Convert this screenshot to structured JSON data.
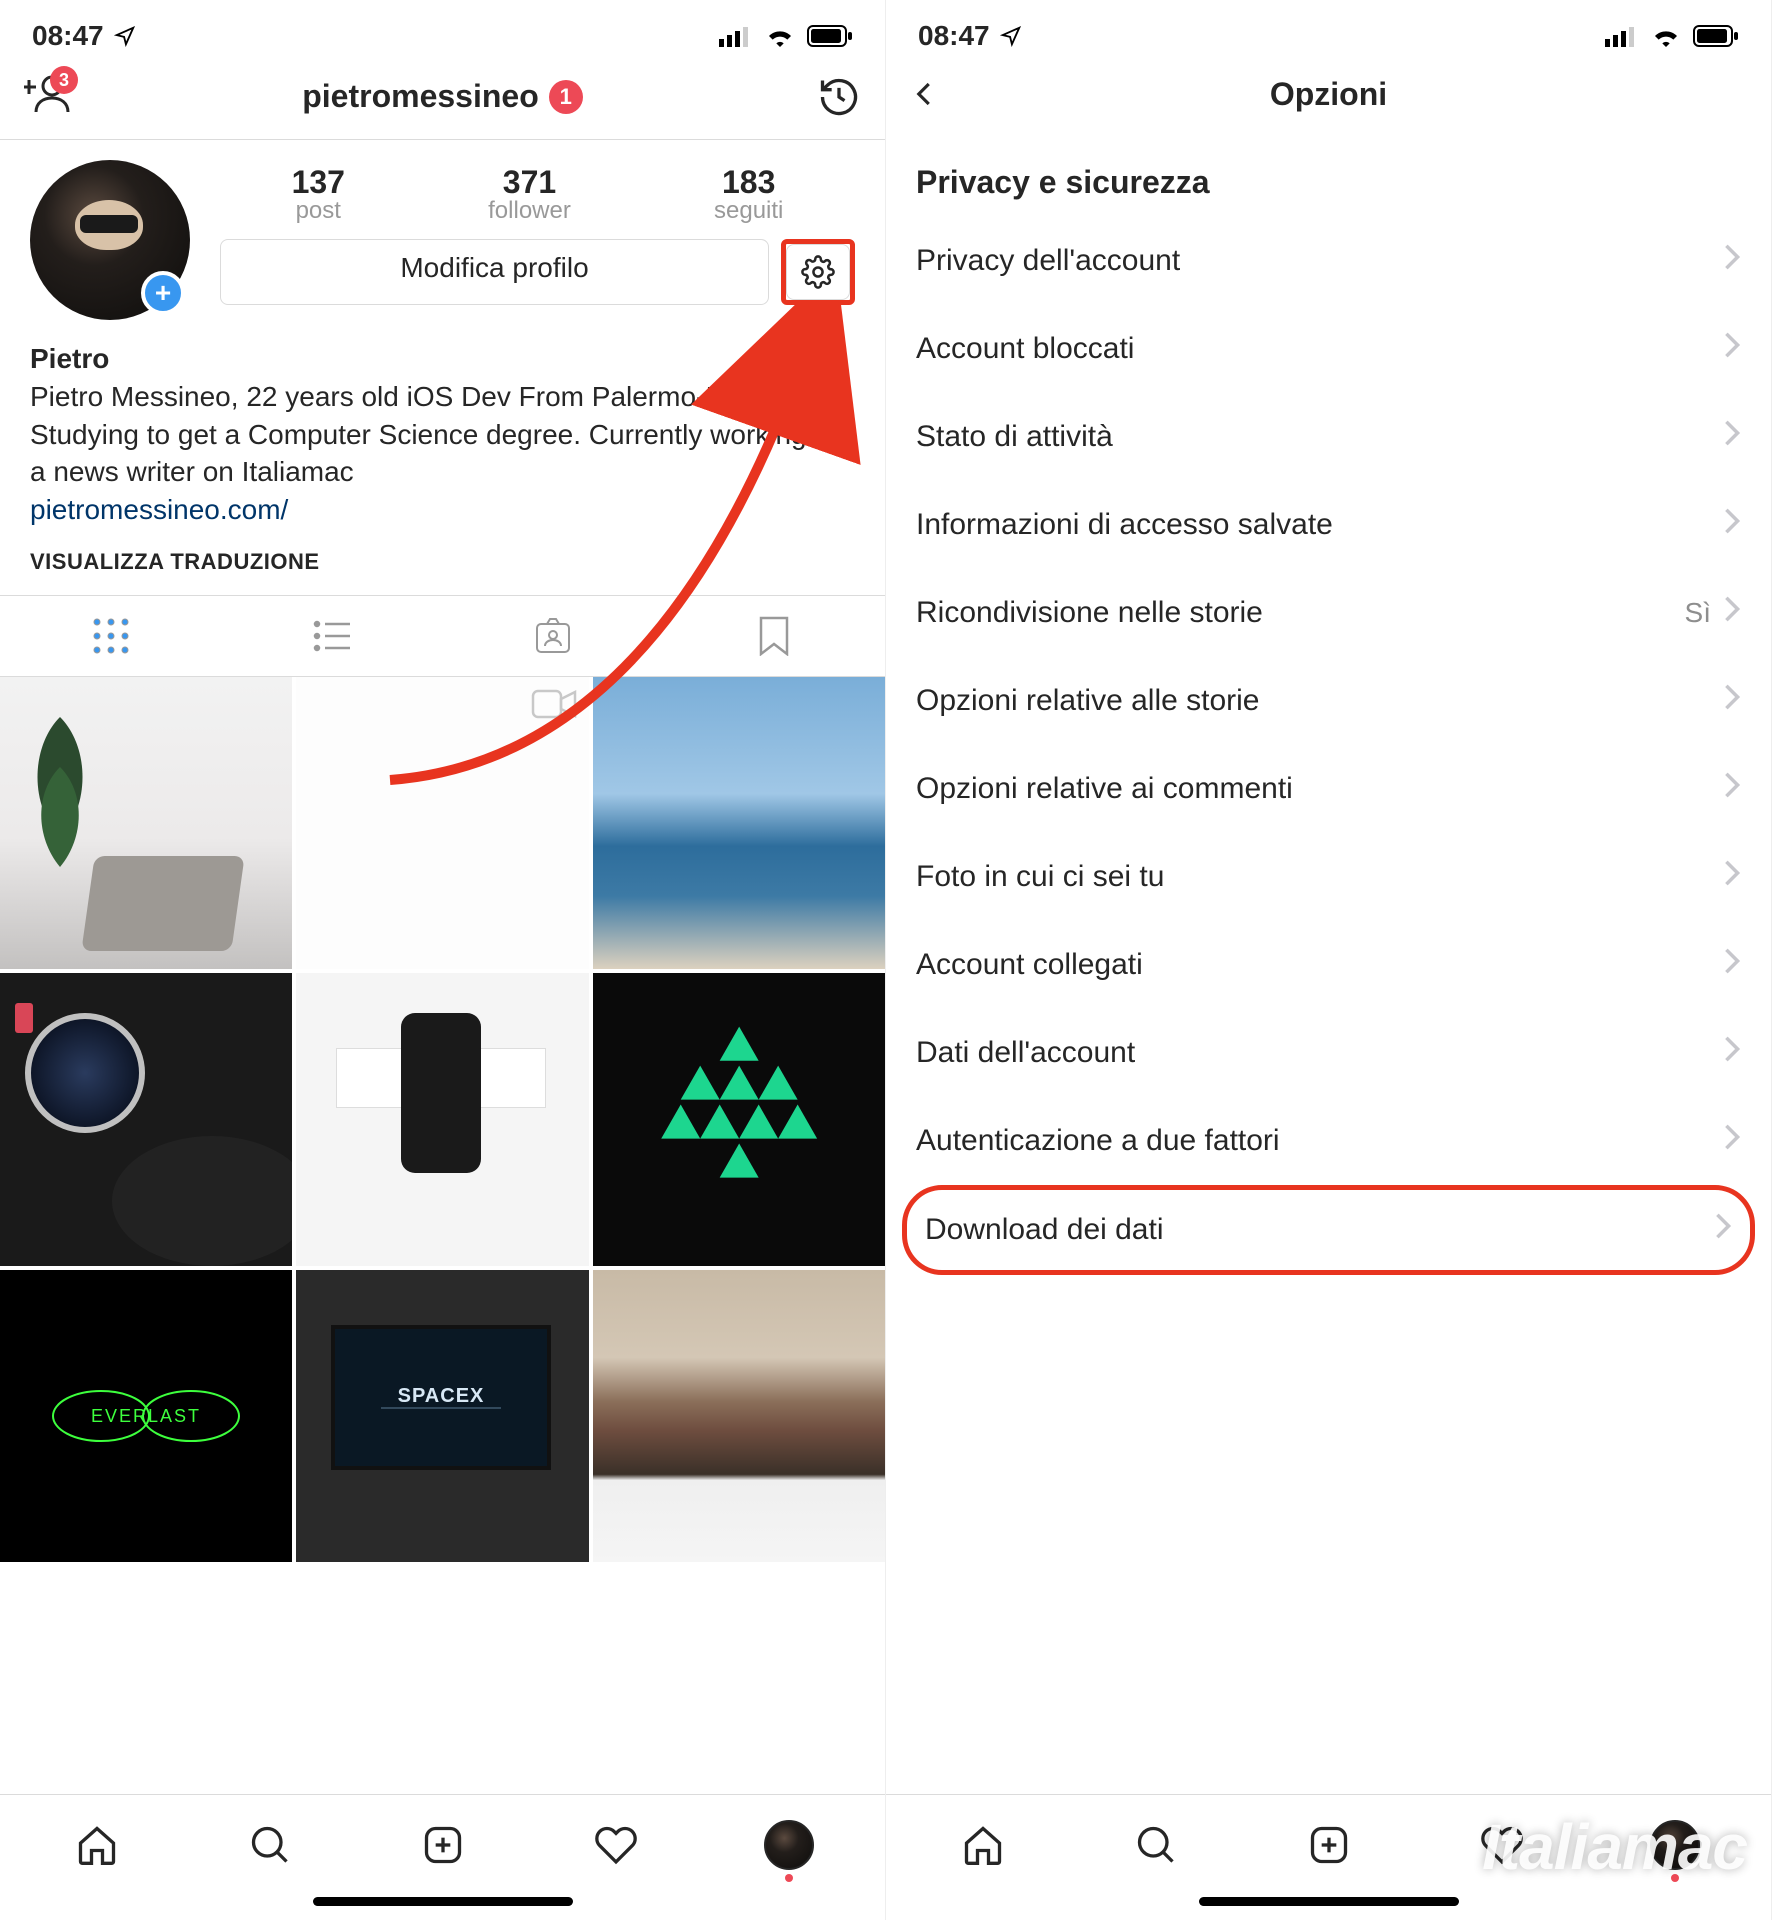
{
  "status": {
    "time": "08:47"
  },
  "left": {
    "add_people_badge": "3",
    "username": "pietromessineo",
    "username_badge": "1",
    "stats": {
      "posts": {
        "num": "137",
        "lbl": "post"
      },
      "followers": {
        "num": "371",
        "lbl": "follower"
      },
      "following": {
        "num": "183",
        "lbl": "seguiti"
      }
    },
    "edit_profile": "Modifica profilo",
    "bio_name": "Pietro ",
    "bio_text": "Pietro Messineo, 22 years old iOS Dev From Palermo-Italy 🇮🇹Studying to get a Computer Science degree. Currently working as a news writer on Italiamac",
    "bio_link": "pietromessineo.com/",
    "translate": "VISUALIZZA TRADUZIONE"
  },
  "right": {
    "title": "Opzioni",
    "section": "Privacy e sicurezza",
    "items": [
      {
        "label": "Privacy dell'account",
        "value": ""
      },
      {
        "label": "Account bloccati",
        "value": ""
      },
      {
        "label": "Stato di attività",
        "value": ""
      },
      {
        "label": "Informazioni di accesso salvate",
        "value": ""
      },
      {
        "label": "Ricondivisione nelle storie",
        "value": "Sì"
      },
      {
        "label": "Opzioni relative alle storie",
        "value": ""
      },
      {
        "label": "Opzioni relative ai commenti",
        "value": ""
      },
      {
        "label": "Foto in cui ci sei tu",
        "value": ""
      },
      {
        "label": "Account collegati",
        "value": ""
      },
      {
        "label": "Dati dell'account",
        "value": ""
      },
      {
        "label": "Autenticazione a due fattori",
        "value": ""
      },
      {
        "label": "Download dei dati",
        "value": ""
      }
    ]
  },
  "watermark": "Italiamac"
}
